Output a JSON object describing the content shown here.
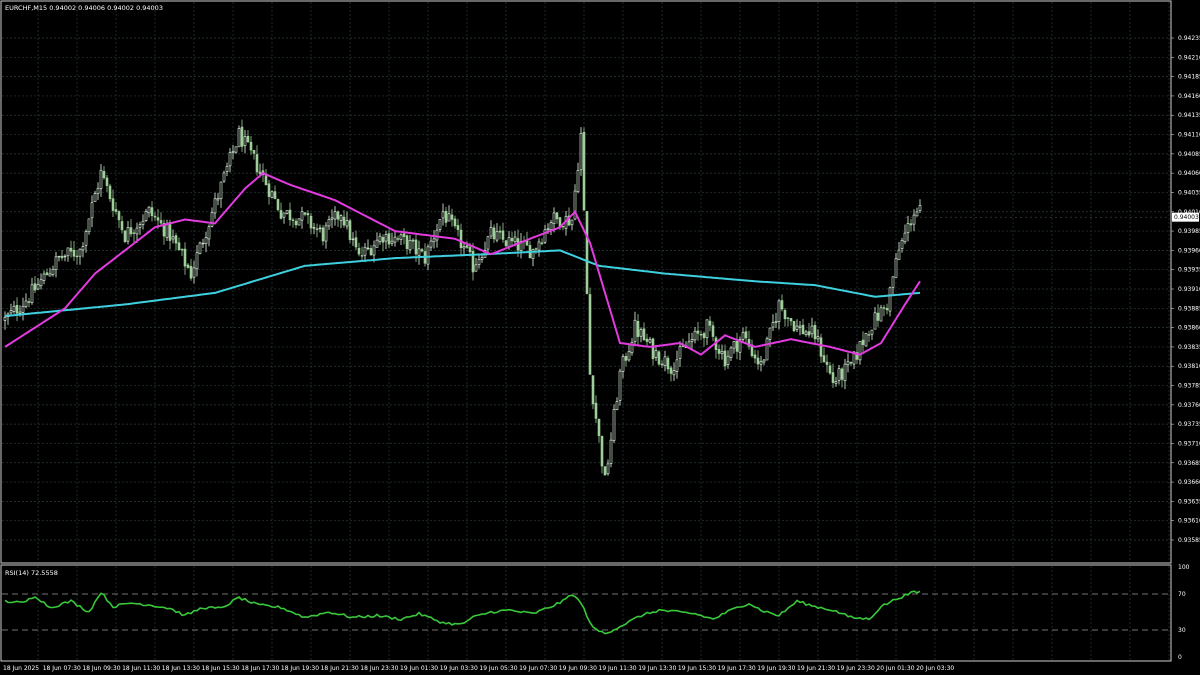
{
  "header": {
    "symbol_info": "EURCHF,M15  0.94002 0.94006 0.94002 0.94003"
  },
  "price_tag": "0.94003",
  "rsi": {
    "label": "RSI(14) 72.5558"
  },
  "colors": {
    "background": "#000000",
    "grid": "#2a3a3a",
    "candle_bull": "#e8ffe8",
    "candle_bear": "#9fcf9a",
    "ma_fast": "#e23be0",
    "ma_slow": "#3fd0e0",
    "rsi_line": "#39c83a",
    "rsi_levels": "#9a9a9a"
  },
  "chart_data": [
    {
      "type": "candlestick",
      "symbol": "EURCHF",
      "timeframe": "M15",
      "y_ticks": [
        "0.94235",
        "0.94210",
        "0.94185",
        "0.94160",
        "0.94135",
        "0.94110",
        "0.94085",
        "0.94060",
        "0.94035",
        "0.94010",
        "0.93985",
        "0.93960",
        "0.93935",
        "0.93910",
        "0.93885",
        "0.93860",
        "0.93835",
        "0.93810",
        "0.93785",
        "0.93760",
        "0.93735",
        "0.93710",
        "0.93685",
        "0.93660",
        "0.93635",
        "0.93610",
        "0.93585"
      ],
      "ylim": [
        0.93585,
        0.94235
      ],
      "x_labels": [
        "18 Jun 2025",
        "18 Jun 07:30",
        "18 Jun 09:30",
        "18 Jun 11:30",
        "18 Jun 13:30",
        "18 Jun 15:30",
        "18 Jun 17:30",
        "18 Jun 19:30",
        "18 Jun 21:30",
        "18 Jun 23:30",
        "19 Jun 01:30",
        "19 Jun 03:30",
        "19 Jun 05:30",
        "19 Jun 07:30",
        "19 Jun 09:30",
        "19 Jun 11:30",
        "19 Jun 13:30",
        "19 Jun 15:30",
        "19 Jun 17:30",
        "19 Jun 19:30",
        "19 Jun 21:30",
        "19 Jun 23:30",
        "20 Jun 01:30",
        "20 Jun 03:30"
      ],
      "close_anchors": [
        [
          0,
          0.9387
        ],
        [
          8,
          0.939
        ],
        [
          18,
          0.9395
        ],
        [
          25,
          0.9396
        ],
        [
          32,
          0.9406
        ],
        [
          40,
          0.9398
        ],
        [
          48,
          0.9401
        ],
        [
          55,
          0.9398
        ],
        [
          62,
          0.9393
        ],
        [
          70,
          0.9402
        ],
        [
          78,
          0.9411
        ],
        [
          84,
          0.9407
        ],
        [
          92,
          0.9401
        ],
        [
          100,
          0.94
        ],
        [
          106,
          0.9398
        ],
        [
          112,
          0.9401
        ],
        [
          118,
          0.9395
        ],
        [
          126,
          0.9398
        ],
        [
          134,
          0.9397
        ],
        [
          140,
          0.9395
        ],
        [
          146,
          0.9401
        ],
        [
          152,
          0.9397
        ],
        [
          156,
          0.9394
        ],
        [
          162,
          0.9398
        ],
        [
          168,
          0.9397
        ],
        [
          176,
          0.9396
        ],
        [
          182,
          0.94
        ],
        [
          189,
          0.94
        ],
        [
          192,
          0.9411
        ],
        [
          195,
          0.938
        ],
        [
          200,
          0.9366
        ],
        [
          205,
          0.938
        ],
        [
          210,
          0.9386
        ],
        [
          216,
          0.9383
        ],
        [
          222,
          0.9381
        ],
        [
          228,
          0.9384
        ],
        [
          234,
          0.9386
        ],
        [
          240,
          0.9382
        ],
        [
          246,
          0.9385
        ],
        [
          252,
          0.9381
        ],
        [
          258,
          0.9389
        ],
        [
          264,
          0.9386
        ],
        [
          270,
          0.9385
        ],
        [
          276,
          0.9379
        ],
        [
          282,
          0.9381
        ],
        [
          288,
          0.9386
        ],
        [
          294,
          0.9389
        ],
        [
          298,
          0.9396
        ],
        [
          303,
          0.9401
        ],
        [
          305,
          0.9401
        ]
      ],
      "ma_fast_anchors": [
        [
          0,
          0.93835
        ],
        [
          20,
          0.93885
        ],
        [
          30,
          0.9393
        ],
        [
          50,
          0.9399
        ],
        [
          60,
          0.94
        ],
        [
          70,
          0.93995
        ],
        [
          80,
          0.9404
        ],
        [
          86,
          0.9406
        ],
        [
          95,
          0.94045
        ],
        [
          110,
          0.94025
        ],
        [
          130,
          0.93985
        ],
        [
          150,
          0.93975
        ],
        [
          162,
          0.93955
        ],
        [
          175,
          0.93975
        ],
        [
          185,
          0.9399
        ],
        [
          190,
          0.9401
        ],
        [
          195,
          0.9397
        ],
        [
          205,
          0.9384
        ],
        [
          215,
          0.93835
        ],
        [
          225,
          0.9384
        ],
        [
          232,
          0.93825
        ],
        [
          240,
          0.9385
        ],
        [
          250,
          0.93835
        ],
        [
          262,
          0.93845
        ],
        [
          275,
          0.93835
        ],
        [
          285,
          0.93825
        ],
        [
          292,
          0.9384
        ],
        [
          300,
          0.9389
        ],
        [
          305,
          0.9392
        ]
      ],
      "ma_slow_anchors": [
        [
          0,
          0.93875
        ],
        [
          40,
          0.9389
        ],
        [
          70,
          0.93905
        ],
        [
          100,
          0.9394
        ],
        [
          130,
          0.9395
        ],
        [
          160,
          0.93955
        ],
        [
          185,
          0.9396
        ],
        [
          198,
          0.9394
        ],
        [
          220,
          0.9393
        ],
        [
          250,
          0.9392
        ],
        [
          270,
          0.93915
        ],
        [
          290,
          0.939
        ],
        [
          305,
          0.93905
        ]
      ],
      "current_price": 0.94003
    },
    {
      "type": "line",
      "name": "RSI(14) 72.5558",
      "y_ticks": [
        "100",
        "70",
        "30",
        "0"
      ],
      "ylim": [
        0,
        100
      ],
      "levels": [
        70,
        30
      ],
      "anchors": [
        [
          0,
          62
        ],
        [
          6,
          60
        ],
        [
          10,
          68
        ],
        [
          15,
          55
        ],
        [
          22,
          62
        ],
        [
          28,
          50
        ],
        [
          32,
          72
        ],
        [
          36,
          56
        ],
        [
          42,
          60
        ],
        [
          48,
          58
        ],
        [
          55,
          54
        ],
        [
          60,
          46
        ],
        [
          66,
          55
        ],
        [
          72,
          54
        ],
        [
          78,
          66
        ],
        [
          84,
          58
        ],
        [
          92,
          55
        ],
        [
          100,
          44
        ],
        [
          108,
          50
        ],
        [
          116,
          44
        ],
        [
          124,
          46
        ],
        [
          132,
          42
        ],
        [
          138,
          48
        ],
        [
          146,
          38
        ],
        [
          152,
          36
        ],
        [
          156,
          44
        ],
        [
          162,
          50
        ],
        [
          168,
          52
        ],
        [
          176,
          48
        ],
        [
          182,
          56
        ],
        [
          186,
          62
        ],
        [
          189,
          70
        ],
        [
          192,
          60
        ],
        [
          196,
          32
        ],
        [
          200,
          26
        ],
        [
          205,
          34
        ],
        [
          212,
          46
        ],
        [
          218,
          52
        ],
        [
          224,
          50
        ],
        [
          230,
          48
        ],
        [
          236,
          42
        ],
        [
          242,
          52
        ],
        [
          248,
          60
        ],
        [
          252,
          52
        ],
        [
          258,
          46
        ],
        [
          264,
          62
        ],
        [
          270,
          56
        ],
        [
          276,
          52
        ],
        [
          282,
          44
        ],
        [
          288,
          42
        ],
        [
          292,
          56
        ],
        [
          298,
          66
        ],
        [
          303,
          72
        ],
        [
          305,
          72
        ]
      ]
    }
  ]
}
